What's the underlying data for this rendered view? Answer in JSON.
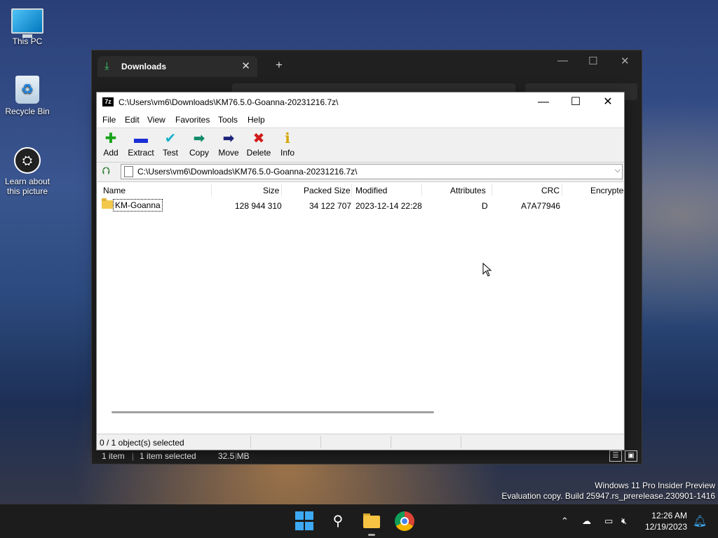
{
  "desktop": {
    "icons": [
      {
        "label": "This PC"
      },
      {
        "label": "Recycle Bin"
      },
      {
        "label": "Learn about this picture"
      }
    ],
    "watermark": {
      "line1": "Windows 11 Pro Insider Preview",
      "line2": "Evaluation copy. Build 25947.rs_prerelease.230901-1416"
    }
  },
  "explorer": {
    "tab_title": "Downloads",
    "tab_close": "✕",
    "new_tab": "+",
    "status": {
      "count": "1 item",
      "selected": "1 item selected",
      "size": "32.5 MB"
    }
  },
  "sevenzip": {
    "title": "C:\\Users\\vm6\\Downloads\\KM76.5.0-Goanna-20231216.7z\\",
    "app_icon": "7z",
    "menu": [
      "File",
      "Edit",
      "View",
      "Favorites",
      "Tools",
      "Help"
    ],
    "toolbar": [
      {
        "label": "Add",
        "icon": "plus-icon",
        "color": "#16a31a"
      },
      {
        "label": "Extract",
        "icon": "minus-icon",
        "color": "#1a2fd6"
      },
      {
        "label": "Test",
        "icon": "check-icon",
        "color": "#17b3c9"
      },
      {
        "label": "Copy",
        "icon": "copy-arrow-icon",
        "color": "#0f8a6a"
      },
      {
        "label": "Move",
        "icon": "move-arrow-icon",
        "color": "#1b237a"
      },
      {
        "label": "Delete",
        "icon": "delete-x-icon",
        "color": "#d21b1b"
      },
      {
        "label": "Info",
        "icon": "info-icon",
        "color": "#d4a500"
      }
    ],
    "address": "C:\\Users\\vm6\\Downloads\\KM76.5.0-Goanna-20231216.7z\\",
    "columns": [
      "Name",
      "Size",
      "Packed Size",
      "Modified",
      "Attributes",
      "CRC",
      "Encrypte"
    ],
    "rows": [
      {
        "name": "KM-Goanna",
        "size": "128 944 310",
        "packed": "34 122 707",
        "modified": "2023-12-14 22:28",
        "attributes": "D",
        "crc": "A7A77946"
      }
    ],
    "status": "0 / 1 object(s) selected"
  },
  "taskbar": {
    "time": "12:26 AM",
    "date": "12/19/2023"
  }
}
